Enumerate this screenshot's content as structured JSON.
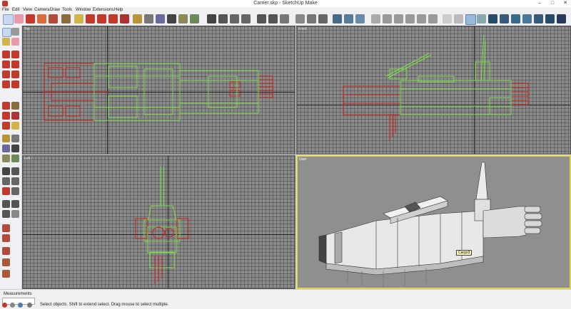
{
  "window": {
    "title": "Carrier.skp - SketchUp Make",
    "minimize": "–",
    "maximize": "□",
    "close": "✕"
  },
  "menu": [
    "File",
    "Edit",
    "View",
    "Camera",
    "Draw",
    "Tools",
    "Window",
    "Extensions",
    "Help"
  ],
  "viewports": {
    "top": "Top",
    "front": "Front",
    "left": "Left",
    "user": "User"
  },
  "tooltip": "Cargo3",
  "statusbar": {
    "measurements_label": "Measurements",
    "measurements_value": "",
    "hint": "Select objects. Shift to extend select. Drag mouse to select multiple."
  },
  "colors": {
    "selected_red": "#d0201c",
    "selected_green": "#7be04a",
    "perspective_border": "#e0d24a"
  },
  "icons": [
    "select-icon",
    "eraser-icon",
    "paint-bucket-icon",
    "line-icon",
    "arc-icon",
    "rectangle-icon",
    "push-pull-icon",
    "move-icon",
    "rotate-icon",
    "scale-icon",
    "offset-icon",
    "tape-measure-icon",
    "text-icon",
    "orbit-icon",
    "pan-icon",
    "zoom-icon",
    "zoom-extents-icon",
    "walk-icon",
    "look-around-icon",
    "section-plane-icon"
  ]
}
